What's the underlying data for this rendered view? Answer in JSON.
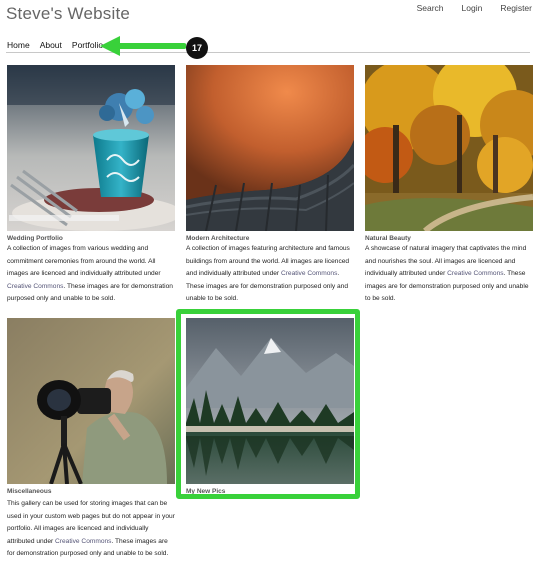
{
  "header": {
    "site_title": "Steve's Website",
    "top_links": [
      "Search",
      "Login",
      "Register"
    ]
  },
  "nav": {
    "items": [
      "Home",
      "About",
      "Portfolio"
    ]
  },
  "annotation": {
    "step_number": "17",
    "arrow_color": "#39d13a",
    "highlight_color": "#39d13a"
  },
  "galleries": [
    {
      "title": "Wedding Portfolio",
      "desc_before": "A collection of images from various wedding and commitment ceremonies from around the world. All images are licenced and individually attributed under",
      "link": "Creative Commons",
      "desc_after": ". These images are for demonstration purposed only and unable to be sold."
    },
    {
      "title": "Modern Architecture",
      "desc_before": "A collection of images featuring architecture and famous buildings from around the world. All images are licenced and individually attributed under",
      "link": "Creative Commons",
      "desc_after": ". These images are for demonstration purposed only and unable to be sold."
    },
    {
      "title": "Natural Beauty",
      "desc_before": "A showcase of natural imagery that captivates the mind and nourishes the soul. All images are licenced and individually attributed under",
      "link": "Creative Commons",
      "desc_after": ". These images are for demonstration purposed only and unable to be sold."
    },
    {
      "title": "Miscellaneous",
      "desc_before": "This gallery can be used for storing images that can be used in your custom web pages but do not appear in your portfolio. All images are licenced and individually attributed under",
      "link": "Creative Commons",
      "desc_after": ". These images are for demonstration purposed only and unable to be sold."
    },
    {
      "title": "My New Pics"
    }
  ]
}
